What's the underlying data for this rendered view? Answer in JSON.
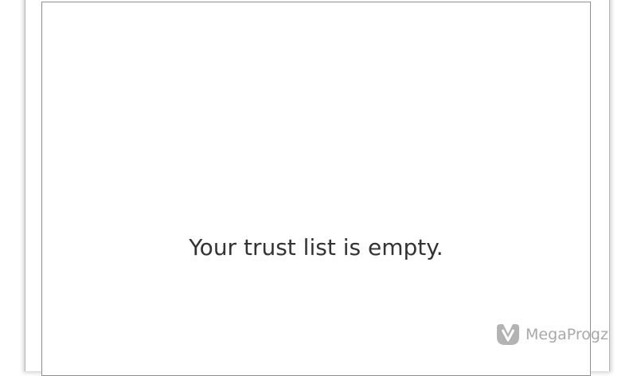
{
  "trust_list": {
    "empty_message": "Your trust list is empty."
  },
  "watermark": {
    "text": "MegaProgz",
    "icon": "megaprogz-logo-icon",
    "color": "#8c8c8c"
  }
}
